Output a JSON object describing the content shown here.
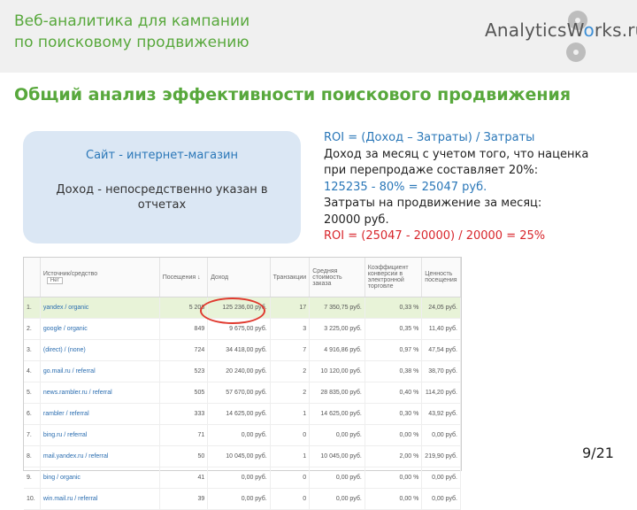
{
  "header": {
    "title_line1": "Веб-аналитика для кампании",
    "title_line2": "по поисковому продвижению",
    "logo_text_a": "AnalyticsW",
    "logo_text_o": "o",
    "logo_text_b": "rks.ru"
  },
  "section_title": "Общий анализ эффективности поискового продвижения",
  "info_box": {
    "line1": "Сайт - интернет-магазин",
    "line2": "Доход - непосредственно указан в отчетах"
  },
  "calc": {
    "l1": "ROI = (Доход – Затраты) / Затраты",
    "l2": "Доход за месяц с учетом того, что наценка",
    "l3": "при перепродаже составляет 20%:",
    "l4": "125235 - 80% = 25047 руб.",
    "l5": "Затраты на продвижение за месяц:",
    "l6": "20000 руб.",
    "l7": "ROI = (25047 - 20000) / 20000 = 25%"
  },
  "table": {
    "headers": [
      "",
      "Источник/средство",
      "Посещения ↓",
      "Доход",
      "Транзакции",
      "Средняя стоимость заказа",
      "Коэффициент конверсии в электронной торговле",
      "Ценность посещения"
    ],
    "filter_label": "Нет",
    "rows": [
      [
        "1.",
        "yandex / organic",
        "5 208",
        "125 236,00 руб.",
        "17",
        "7 350,75 руб.",
        "0,33 %",
        "24,05 руб."
      ],
      [
        "2.",
        "google / organic",
        "849",
        "9 675,00 руб.",
        "3",
        "3 225,00 руб.",
        "0,35 %",
        "11,40 руб."
      ],
      [
        "3.",
        "(direct) / (none)",
        "724",
        "34 418,00 руб.",
        "7",
        "4 916,86 руб.",
        "0,97 %",
        "47,54 руб."
      ],
      [
        "4.",
        "go.mail.ru / referral",
        "523",
        "20 240,00 руб.",
        "2",
        "10 120,00 руб.",
        "0,38 %",
        "38,70 руб."
      ],
      [
        "5.",
        "news.rambler.ru / referral",
        "505",
        "57 670,00 руб.",
        "2",
        "28 835,00 руб.",
        "0,40 %",
        "114,20 руб."
      ],
      [
        "6.",
        "rambler / referral",
        "333",
        "14 625,00 руб.",
        "1",
        "14 625,00 руб.",
        "0,30 %",
        "43,92 руб."
      ],
      [
        "7.",
        "bing.ru / referral",
        "71",
        "0,00 руб.",
        "0",
        "0,00 руб.",
        "0,00 %",
        "0,00 руб."
      ],
      [
        "8.",
        "mail.yandex.ru / referral",
        "50",
        "10 045,00 руб.",
        "1",
        "10 045,00 руб.",
        "2,00 %",
        "219,90 руб."
      ],
      [
        "9.",
        "bing / organic",
        "41",
        "0,00 руб.",
        "0",
        "0,00 руб.",
        "0,00 %",
        "0,00 руб."
      ],
      [
        "10.",
        "win.mail.ru / referral",
        "39",
        "0,00 руб.",
        "0",
        "0,00 руб.",
        "0,00 %",
        "0,00 руб."
      ]
    ]
  },
  "page_number": "9/21",
  "colors": {
    "accent_green": "#58a83c",
    "accent_blue": "#2a77b8",
    "accent_red": "#d8262c"
  }
}
